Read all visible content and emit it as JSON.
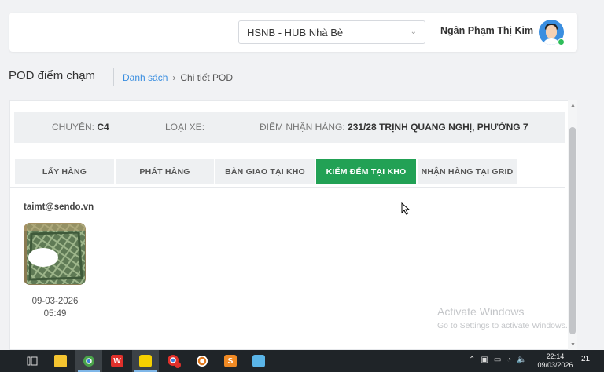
{
  "header": {
    "hub_select": "HSNB - HUB Nhà Bè",
    "user_name": "Ngân Phạm Thị Kim"
  },
  "page": {
    "title": "POD điểm chạm",
    "breadcrumb": {
      "link": "Danh sách",
      "separator": "›",
      "current": "Chi tiết POD"
    }
  },
  "info": {
    "chuyen_label": "CHUYẾN:",
    "chuyen_value": "C4",
    "loai_xe_label": "LOẠI XE:",
    "loai_xe_value": "",
    "diem_label": "ĐIỂM NHẬN HÀNG:",
    "diem_value": "231/28 TRỊNH QUANG NGHỊ, PHƯỜNG 7"
  },
  "tabs": [
    {
      "label": "LẤY HÀNG",
      "active": false
    },
    {
      "label": "PHÁT HÀNG",
      "active": false
    },
    {
      "label": "BÀN GIAO TẠI KHO",
      "active": false
    },
    {
      "label": "KIỂM ĐẾM TẠI KHO",
      "active": true
    },
    {
      "label": "NHẬN HÀNG TẠI GRID",
      "active": false
    }
  ],
  "record": {
    "email": "taimt@sendo.vn",
    "date": "09-03-2026",
    "time": "05:49"
  },
  "watermark": {
    "line1": "Activate Windows",
    "line2": "Go to Settings to activate Windows."
  },
  "taskbar": {
    "apps": [
      "task-view-icon",
      "file-explorer-icon",
      "chrome-icon",
      "wps-office-icon",
      "sticky-notes-icon",
      "chrome-profile-icon",
      "app-icon",
      "sublime-text-icon",
      "notepad-icon"
    ],
    "badge": "1",
    "tray_language": "ENG",
    "clock_time": "22:14",
    "clock_date": "09/03/2026",
    "notification_count": "21"
  },
  "colors": {
    "accent": "#22a155",
    "link": "#3a8ee0",
    "taskbar": "#1f2428"
  }
}
